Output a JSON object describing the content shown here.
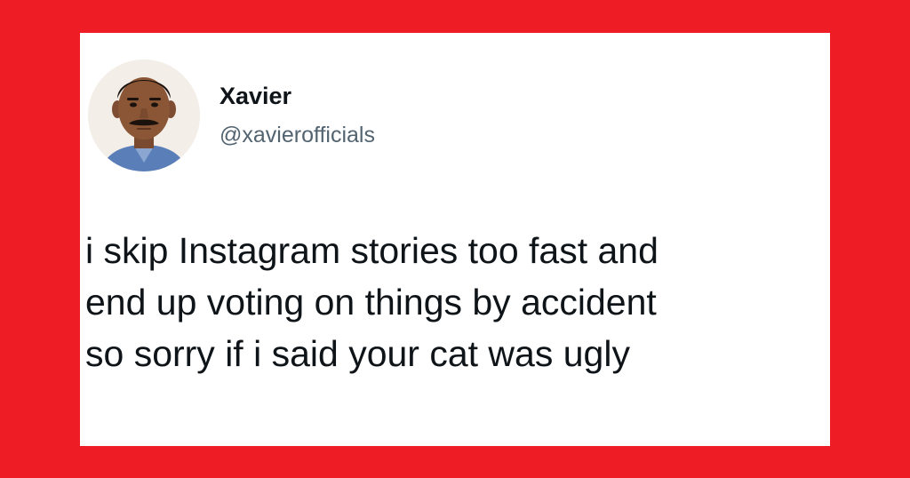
{
  "page": {
    "background_color": "#ee1c25",
    "card_color": "#ffffff"
  },
  "tweet": {
    "author": {
      "display_name": "Xavier",
      "handle": "@xavierofficials",
      "avatar_icon": "profile-photo-avatar"
    },
    "text": "i skip Instagram stories too fast and\nend up voting on things by accident\nso sorry if i said your cat was ugly"
  }
}
